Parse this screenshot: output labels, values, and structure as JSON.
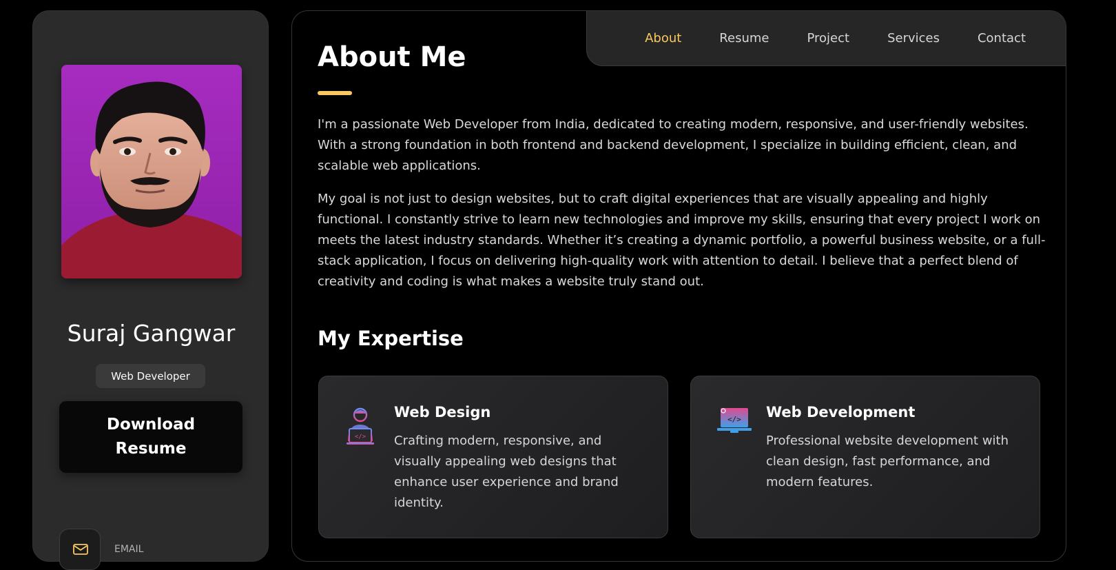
{
  "sidebar": {
    "name": "Suraj Gangwar",
    "role": "Web Developer",
    "download_label": "Download\nResume",
    "contact": {
      "label": "EMAIL",
      "icon": "mail-icon"
    }
  },
  "nav": {
    "items": [
      {
        "label": "About",
        "active": true
      },
      {
        "label": "Resume",
        "active": false
      },
      {
        "label": "Project",
        "active": false
      },
      {
        "label": "Services",
        "active": false
      },
      {
        "label": "Contact",
        "active": false
      }
    ],
    "active_color": "#f9c85e"
  },
  "about": {
    "title": "About Me",
    "paragraphs": [
      "I'm a passionate Web Developer from India, dedicated to creating modern, responsive, and user-friendly websites. With a strong foundation in both frontend and backend development, I specialize in building efficient, clean, and scalable web applications.",
      "My goal is not just to design websites, but to craft digital experiences that are visually appealing and highly functional. I constantly strive to learn new technologies and improve my skills, ensuring that every project I work on meets the latest industry standards. Whether it’s creating a dynamic portfolio, a powerful business website, or a full-stack application, I focus on delivering high-quality work with attention to detail. I believe that a perfect blend of creativity and coding is what makes a website truly stand out."
    ]
  },
  "expertise": {
    "title": "My Expertise",
    "items": [
      {
        "icon": "developer-person-icon",
        "title": "Web Design",
        "text": "Crafting modern, responsive, and visually appealing web designs that enhance user experience and brand identity."
      },
      {
        "icon": "laptop-code-icon",
        "title": "Web Development",
        "text": "Professional website development with clean design, fast performance, and modern features."
      }
    ]
  },
  "colors": {
    "accent": "#f9c85e",
    "sidebar_bg": "#2b2b2b",
    "page_bg": "#000000"
  }
}
